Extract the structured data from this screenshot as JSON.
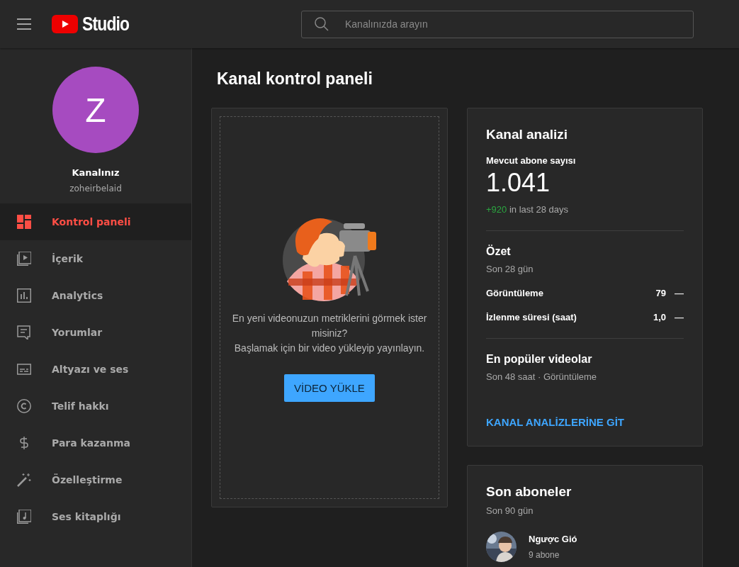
{
  "header": {
    "logo_text": "Studio",
    "search": {
      "placeholder": "Kanalınızda arayın"
    }
  },
  "channel": {
    "avatar_letter": "Z",
    "name": "Kanalınız",
    "handle": "zoheirbelaid"
  },
  "sidebar": {
    "items": [
      {
        "label": "Kontrol paneli",
        "kind": "dashboard",
        "selected": true
      },
      {
        "label": "İçerik",
        "kind": "content",
        "selected": false
      },
      {
        "label": "Analytics",
        "kind": "analytics",
        "selected": false
      },
      {
        "label": "Yorumlar",
        "kind": "comments",
        "selected": false
      },
      {
        "label": "Altyazı ve ses",
        "kind": "subtitles",
        "selected": false
      },
      {
        "label": "Telif hakkı",
        "kind": "copyright",
        "selected": false
      },
      {
        "label": "Para kazanma",
        "kind": "money",
        "selected": false
      },
      {
        "label": "Özelleştirme",
        "kind": "customize",
        "selected": false
      },
      {
        "label": "Ses kitaplığı",
        "kind": "audio",
        "selected": false
      }
    ]
  },
  "page_title": "Kanal kontrol paneli",
  "upload_card": {
    "message_lines": [
      "En yeni videonuzun metriklerini görmek ister misiniz?",
      "Başlamak için bir video yükleyip yayınlayın."
    ],
    "button": "VİDEO YÜKLE"
  },
  "analytics_card": {
    "title": "Kanal analizi",
    "subscribers_label": "Mevcut abone sayısı",
    "subscribers": "1.041",
    "change": "+920",
    "change_suffix": "in last 28 days",
    "summary": {
      "title": "Özet",
      "period": "Son 28 gün",
      "metrics": [
        {
          "label": "Görüntüleme",
          "value": "79",
          "trend": "—"
        },
        {
          "label": "İzlenme süresi (saat)",
          "value": "1,0",
          "trend": "—"
        }
      ]
    },
    "top_videos": {
      "title": "En popüler videolar",
      "subtitle": "Son 48 saat · Görüntüleme"
    },
    "link": "KANAL ANALİZLERİNE GİT"
  },
  "recent_subscribers": {
    "title": "Son aboneler",
    "period": "Son 90 gün",
    "items": [
      {
        "name": "Ngược Gió",
        "count": "9 abone"
      }
    ]
  }
}
